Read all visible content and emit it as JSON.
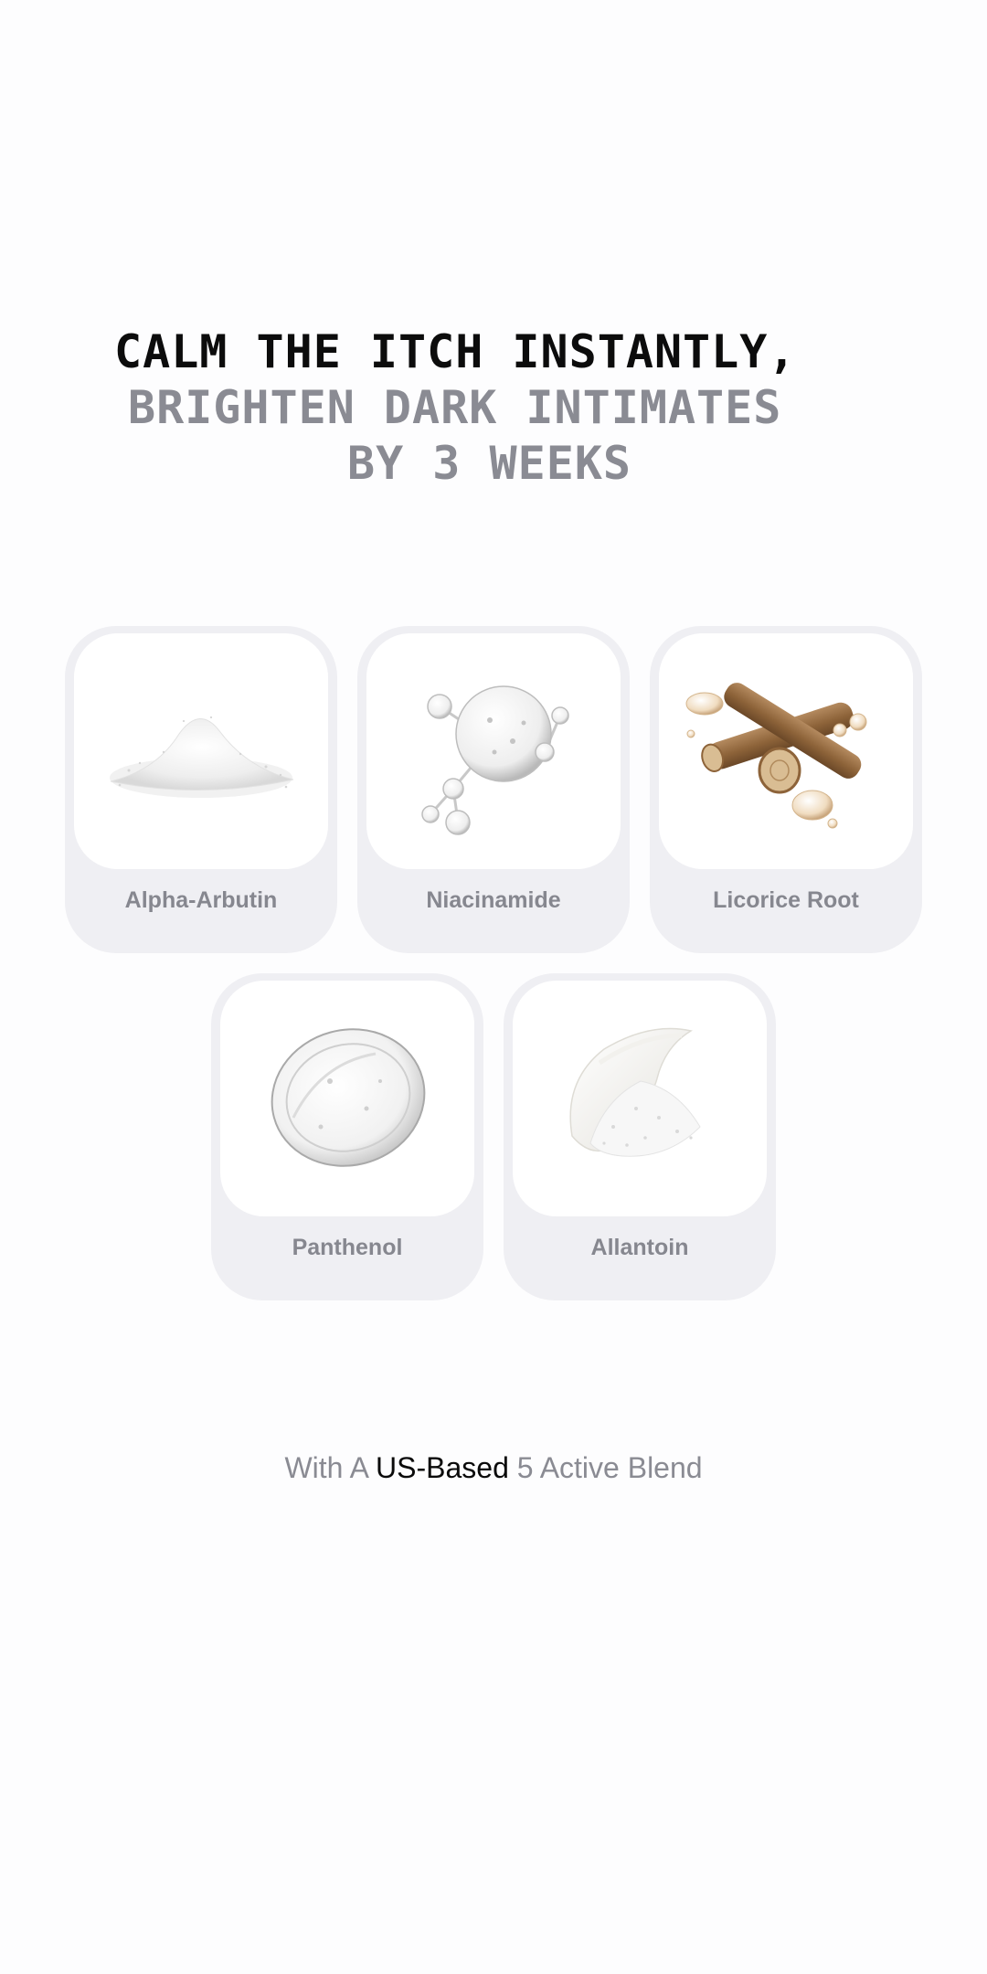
{
  "headline": {
    "line1": "CALM THE ITCH INSTANTLY,",
    "line2": "BRIGHTEN DARK INTIMATES",
    "line3": "BY 3 WEEKS"
  },
  "ingredients": [
    {
      "label": "Alpha-Arbutin",
      "image": "white-powder-pile"
    },
    {
      "label": "Niacinamide",
      "image": "molecule-bubbles"
    },
    {
      "label": "Licorice Root",
      "image": "licorice-root-sticks"
    },
    {
      "label": "Panthenol",
      "image": "clear-gel-swatch"
    },
    {
      "label": "Allantoin",
      "image": "cream-and-powder"
    }
  ],
  "tagline": {
    "prefix": "With A",
    "highlight": "US-Based",
    "suffix": "5 Active Blend"
  },
  "colors": {
    "background": "#fdfdfe",
    "card": "#efeff3",
    "headline_dark": "#0c0c0c",
    "headline_gray": "#8a8b93",
    "label": "#86878f"
  }
}
